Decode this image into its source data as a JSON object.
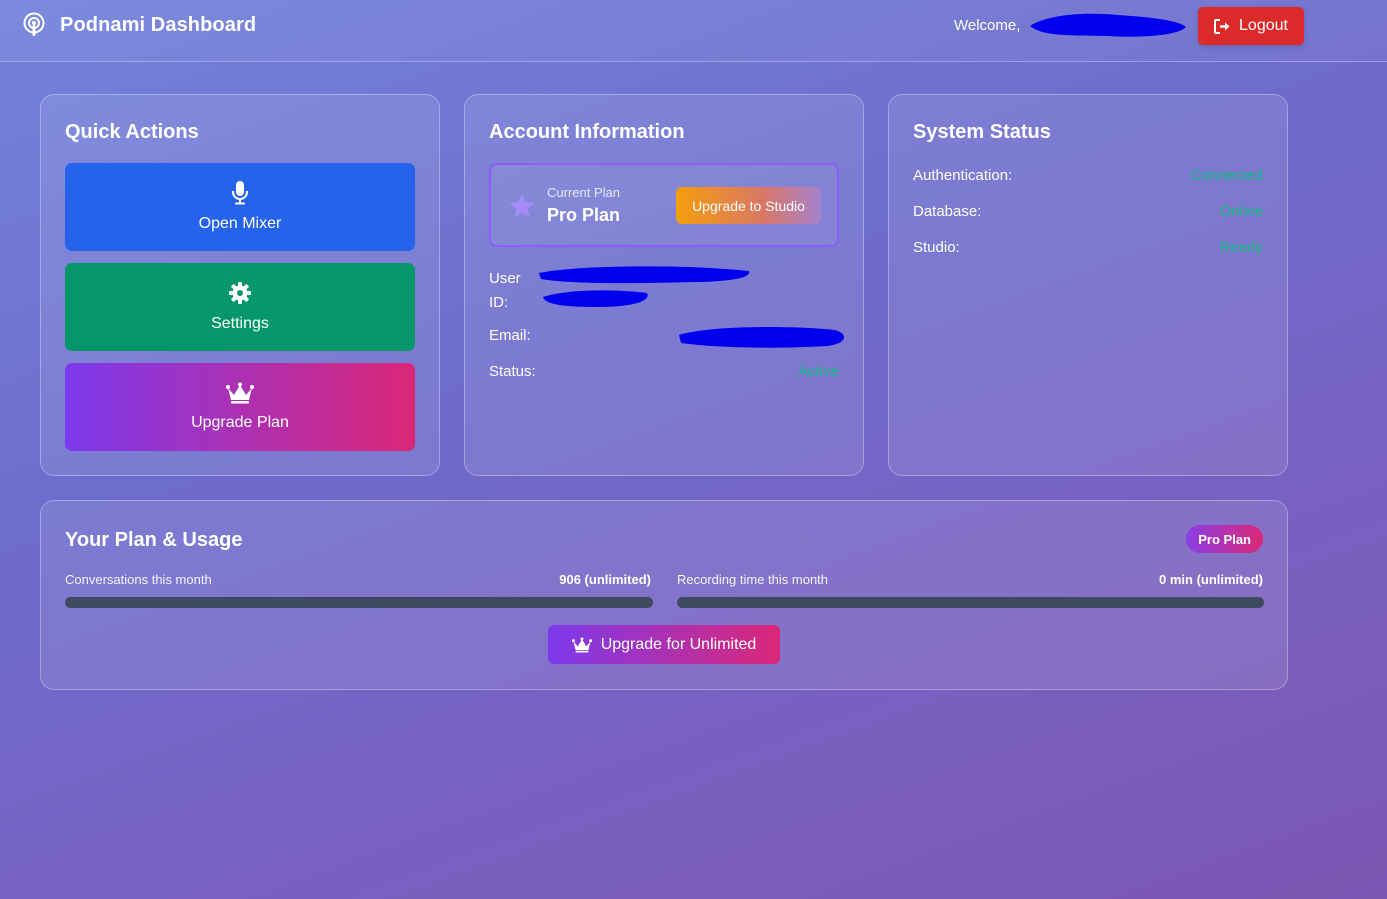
{
  "header": {
    "app_title": "Podnami Dashboard",
    "welcome_text": "Welcome,",
    "logout_label": "Logout"
  },
  "quick_actions": {
    "title": "Quick Actions",
    "buttons": [
      {
        "label": "Open Mixer",
        "icon": "microphone-icon",
        "color": "#2563eb"
      },
      {
        "label": "Settings",
        "icon": "gear-icon",
        "color": "#059669"
      },
      {
        "label": "Upgrade Plan",
        "icon": "crown-icon",
        "color": "#7c3aed"
      }
    ]
  },
  "account": {
    "title": "Account Information",
    "current_plan_label": "Current Plan",
    "plan_name": "Pro Plan",
    "upgrade_button": "Upgrade to Studio",
    "user_id_label": "User ID:",
    "email_label": "Email:",
    "status_label": "Status:",
    "status_value": "Active"
  },
  "system_status": {
    "title": "System Status",
    "rows": [
      {
        "label": "Authentication:",
        "value": "Connected"
      },
      {
        "label": "Database:",
        "value": "Online"
      },
      {
        "label": "Studio:",
        "value": "Ready"
      }
    ]
  },
  "usage": {
    "title": "Your Plan & Usage",
    "badge": "Pro Plan",
    "conversations_label": "Conversations this month",
    "conversations_value": "906 (unlimited)",
    "conversations_progress": 0,
    "recording_label": "Recording time this month",
    "recording_value": "0 min (unlimited)",
    "recording_progress": 0,
    "upgrade_button": "Upgrade for Unlimited"
  },
  "colors": {
    "accent_green": "#10b981",
    "logout_red": "#dc2a2a",
    "redaction_blue": "#0000ee"
  }
}
